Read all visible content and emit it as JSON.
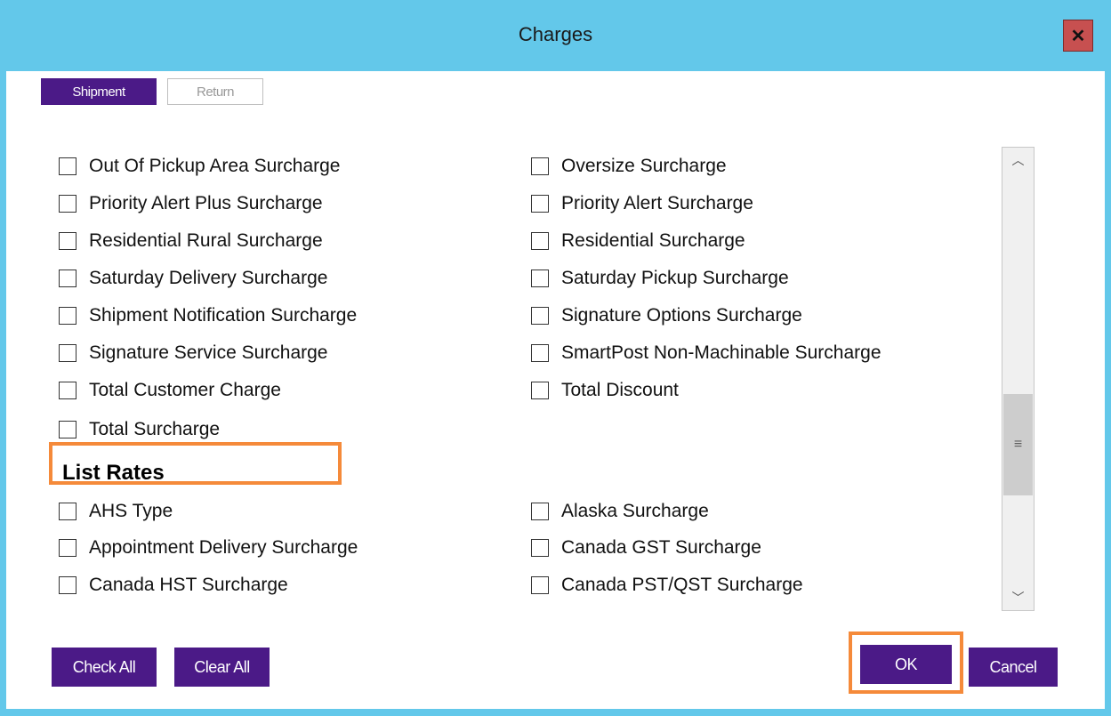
{
  "window": {
    "title": "Charges",
    "close_icon": "close-icon"
  },
  "tabs": {
    "shipment": "Shipment",
    "return": "Return"
  },
  "left_items": [
    "Out Of Pickup Area Surcharge",
    "Priority Alert Plus Surcharge",
    "Residential Rural Surcharge",
    "Saturday Delivery Surcharge",
    "Shipment Notification Surcharge",
    "Signature Service Surcharge",
    "Total Customer Charge",
    "Total Surcharge"
  ],
  "right_items": [
    "Oversize Surcharge",
    "Priority Alert Surcharge",
    "Residential Surcharge",
    "Saturday Pickup Surcharge",
    "Signature Options Surcharge",
    "SmartPost Non-Machinable Surcharge",
    "Total Discount"
  ],
  "list_rates": {
    "heading": "List Rates",
    "left_items": [
      "AHS Type",
      "Appointment Delivery Surcharge",
      "Canada HST Surcharge"
    ],
    "right_items": [
      "Alaska Surcharge",
      "Canada GST Surcharge",
      "Canada PST/QST Surcharge"
    ]
  },
  "buttons": {
    "check_all": "Check All",
    "clear_all": "Clear All",
    "ok": "OK",
    "cancel": "Cancel"
  },
  "colors": {
    "title_bar": "#63c8ea",
    "accent": "#4b1a87",
    "highlight": "#f58a3a",
    "close": "#c75050"
  }
}
